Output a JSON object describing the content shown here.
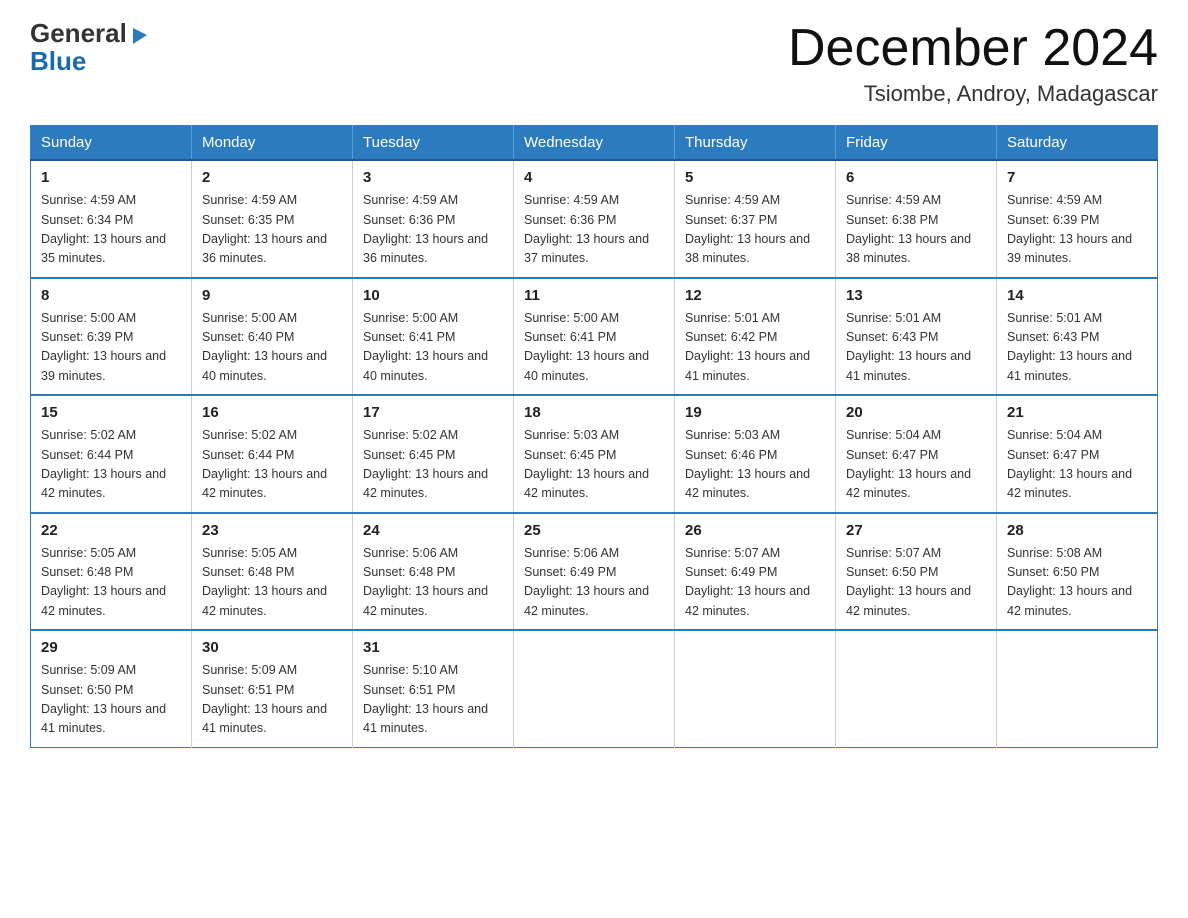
{
  "logo": {
    "general": "General",
    "blue": "Blue",
    "arrow": "▶"
  },
  "header": {
    "title": "December 2024",
    "location": "Tsiombe, Androy, Madagascar"
  },
  "weekdays": [
    "Sunday",
    "Monday",
    "Tuesday",
    "Wednesday",
    "Thursday",
    "Friday",
    "Saturday"
  ],
  "weeks": [
    [
      {
        "day": "1",
        "sunrise": "4:59 AM",
        "sunset": "6:34 PM",
        "daylight": "13 hours and 35 minutes."
      },
      {
        "day": "2",
        "sunrise": "4:59 AM",
        "sunset": "6:35 PM",
        "daylight": "13 hours and 36 minutes."
      },
      {
        "day": "3",
        "sunrise": "4:59 AM",
        "sunset": "6:36 PM",
        "daylight": "13 hours and 36 minutes."
      },
      {
        "day": "4",
        "sunrise": "4:59 AM",
        "sunset": "6:36 PM",
        "daylight": "13 hours and 37 minutes."
      },
      {
        "day": "5",
        "sunrise": "4:59 AM",
        "sunset": "6:37 PM",
        "daylight": "13 hours and 38 minutes."
      },
      {
        "day": "6",
        "sunrise": "4:59 AM",
        "sunset": "6:38 PM",
        "daylight": "13 hours and 38 minutes."
      },
      {
        "day": "7",
        "sunrise": "4:59 AM",
        "sunset": "6:39 PM",
        "daylight": "13 hours and 39 minutes."
      }
    ],
    [
      {
        "day": "8",
        "sunrise": "5:00 AM",
        "sunset": "6:39 PM",
        "daylight": "13 hours and 39 minutes."
      },
      {
        "day": "9",
        "sunrise": "5:00 AM",
        "sunset": "6:40 PM",
        "daylight": "13 hours and 40 minutes."
      },
      {
        "day": "10",
        "sunrise": "5:00 AM",
        "sunset": "6:41 PM",
        "daylight": "13 hours and 40 minutes."
      },
      {
        "day": "11",
        "sunrise": "5:00 AM",
        "sunset": "6:41 PM",
        "daylight": "13 hours and 40 minutes."
      },
      {
        "day": "12",
        "sunrise": "5:01 AM",
        "sunset": "6:42 PM",
        "daylight": "13 hours and 41 minutes."
      },
      {
        "day": "13",
        "sunrise": "5:01 AM",
        "sunset": "6:43 PM",
        "daylight": "13 hours and 41 minutes."
      },
      {
        "day": "14",
        "sunrise": "5:01 AM",
        "sunset": "6:43 PM",
        "daylight": "13 hours and 41 minutes."
      }
    ],
    [
      {
        "day": "15",
        "sunrise": "5:02 AM",
        "sunset": "6:44 PM",
        "daylight": "13 hours and 42 minutes."
      },
      {
        "day": "16",
        "sunrise": "5:02 AM",
        "sunset": "6:44 PM",
        "daylight": "13 hours and 42 minutes."
      },
      {
        "day": "17",
        "sunrise": "5:02 AM",
        "sunset": "6:45 PM",
        "daylight": "13 hours and 42 minutes."
      },
      {
        "day": "18",
        "sunrise": "5:03 AM",
        "sunset": "6:45 PM",
        "daylight": "13 hours and 42 minutes."
      },
      {
        "day": "19",
        "sunrise": "5:03 AM",
        "sunset": "6:46 PM",
        "daylight": "13 hours and 42 minutes."
      },
      {
        "day": "20",
        "sunrise": "5:04 AM",
        "sunset": "6:47 PM",
        "daylight": "13 hours and 42 minutes."
      },
      {
        "day": "21",
        "sunrise": "5:04 AM",
        "sunset": "6:47 PM",
        "daylight": "13 hours and 42 minutes."
      }
    ],
    [
      {
        "day": "22",
        "sunrise": "5:05 AM",
        "sunset": "6:48 PM",
        "daylight": "13 hours and 42 minutes."
      },
      {
        "day": "23",
        "sunrise": "5:05 AM",
        "sunset": "6:48 PM",
        "daylight": "13 hours and 42 minutes."
      },
      {
        "day": "24",
        "sunrise": "5:06 AM",
        "sunset": "6:48 PM",
        "daylight": "13 hours and 42 minutes."
      },
      {
        "day": "25",
        "sunrise": "5:06 AM",
        "sunset": "6:49 PM",
        "daylight": "13 hours and 42 minutes."
      },
      {
        "day": "26",
        "sunrise": "5:07 AM",
        "sunset": "6:49 PM",
        "daylight": "13 hours and 42 minutes."
      },
      {
        "day": "27",
        "sunrise": "5:07 AM",
        "sunset": "6:50 PM",
        "daylight": "13 hours and 42 minutes."
      },
      {
        "day": "28",
        "sunrise": "5:08 AM",
        "sunset": "6:50 PM",
        "daylight": "13 hours and 42 minutes."
      }
    ],
    [
      {
        "day": "29",
        "sunrise": "5:09 AM",
        "sunset": "6:50 PM",
        "daylight": "13 hours and 41 minutes."
      },
      {
        "day": "30",
        "sunrise": "5:09 AM",
        "sunset": "6:51 PM",
        "daylight": "13 hours and 41 minutes."
      },
      {
        "day": "31",
        "sunrise": "5:10 AM",
        "sunset": "6:51 PM",
        "daylight": "13 hours and 41 minutes."
      },
      null,
      null,
      null,
      null
    ]
  ],
  "labels": {
    "sunrise_prefix": "Sunrise: ",
    "sunset_prefix": "Sunset: ",
    "daylight_prefix": "Daylight: "
  }
}
